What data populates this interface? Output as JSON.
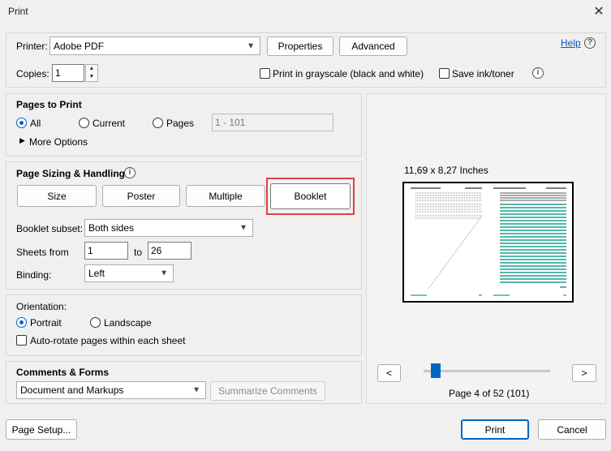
{
  "window": {
    "title": "Print",
    "close_icon": "close-icon"
  },
  "printer": {
    "label": "Printer:",
    "value": "Adobe PDF",
    "properties_label": "Properties",
    "advanced_label": "Advanced",
    "help_label": "Help",
    "copies_label": "Copies:",
    "copies_value": "1",
    "grayscale_label": "Print in grayscale (black and white)",
    "save_ink_label": "Save ink/toner"
  },
  "pages_to_print": {
    "title": "Pages to Print",
    "all_label": "All",
    "current_label": "Current",
    "pages_label": "Pages",
    "pages_value": "1 - 101",
    "more_options_label": "More Options"
  },
  "page_sizing": {
    "title": "Page Sizing & Handling",
    "buttons": [
      "Size",
      "Poster",
      "Multiple",
      "Booklet"
    ],
    "selected": "Booklet",
    "booklet_subset_label": "Booklet subset:",
    "booklet_subset_value": "Both sides",
    "sheets_from_label": "Sheets from",
    "sheets_from_value": "1",
    "to_label": "to",
    "sheets_to_value": "26",
    "binding_label": "Binding:",
    "binding_value": "Left"
  },
  "orientation": {
    "title": "Orientation:",
    "portrait_label": "Portrait",
    "landscape_label": "Landscape",
    "autorotate_label": "Auto-rotate pages within each sheet"
  },
  "comments": {
    "title": "Comments & Forms",
    "value": "Document and Markups",
    "summarize_label": "Summarize Comments"
  },
  "preview": {
    "dimensions": "11,69 x 8,27 Inches",
    "prev_label": "<",
    "next_label": ">",
    "page_status": "Page 4 of 52 (101)",
    "slider_fraction": 0.06,
    "accent_color": "#1aa08e"
  },
  "footer": {
    "page_setup_label": "Page Setup...",
    "print_label": "Print",
    "cancel_label": "Cancel"
  },
  "colors": {
    "highlight_border": "#e04040",
    "accent_blue": "#0067c0"
  }
}
